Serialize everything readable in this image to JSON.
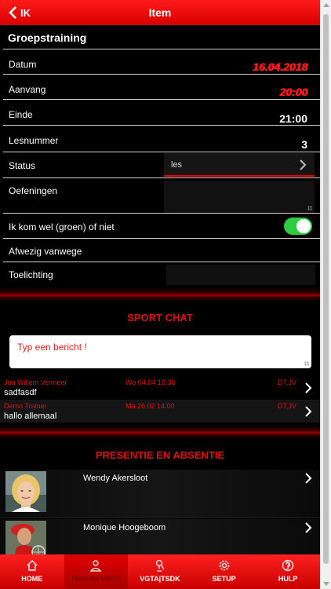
{
  "header": {
    "back_label": "IK",
    "title": "Item"
  },
  "section_title": "Groepstraining",
  "fields": {
    "datum": {
      "label": "Datum",
      "value": "16.04.2018"
    },
    "aanvang": {
      "label": "Aanvang",
      "value": "20:00"
    },
    "einde": {
      "label": "Einde",
      "value": "21:00"
    },
    "lesnummer": {
      "label": "Lesnummer",
      "value": "3"
    },
    "status": {
      "label": "Status",
      "value": "les"
    },
    "oefeningen": {
      "label": "Oefeningen"
    },
    "attendance": {
      "label": "Ik kom wel (groen) of niet",
      "on": true
    },
    "afwezig": {
      "label": "Afwezig vanwege"
    },
    "toelichting": {
      "label": "Toelichting"
    }
  },
  "chat": {
    "title": "SPORT CHAT",
    "placeholder": "Typ een bericht !",
    "messages": [
      {
        "author": "Jan Willem Vermeer",
        "when": "Wo 04.04 16:36",
        "tag": "DT,JV",
        "text": "sadfasdf"
      },
      {
        "author": "Demo Trainer",
        "when": "Ma 26.02 14:00",
        "tag": "DT,JV",
        "text": "hallo allemaal"
      }
    ]
  },
  "presence": {
    "title": "PRESENTIE EN ABSENTIE",
    "people": [
      {
        "name": "Wendy Akersloot"
      },
      {
        "name": "Monique Hoogeboom"
      }
    ]
  },
  "tabbar": {
    "tabs": [
      {
        "label": "HOME",
        "icon": "home-icon"
      },
      {
        "label": "Nina de Vecht",
        "icon": "user-icon"
      },
      {
        "label": "VGTA|TSDK",
        "icon": "club-icon"
      },
      {
        "label": "SETUP",
        "icon": "gear-icon"
      },
      {
        "label": "HULP",
        "icon": "help-icon"
      }
    ]
  },
  "colors": {
    "accent": "#e00000",
    "toggle_on": "#2ecc40",
    "header": "#ff1a1a"
  }
}
